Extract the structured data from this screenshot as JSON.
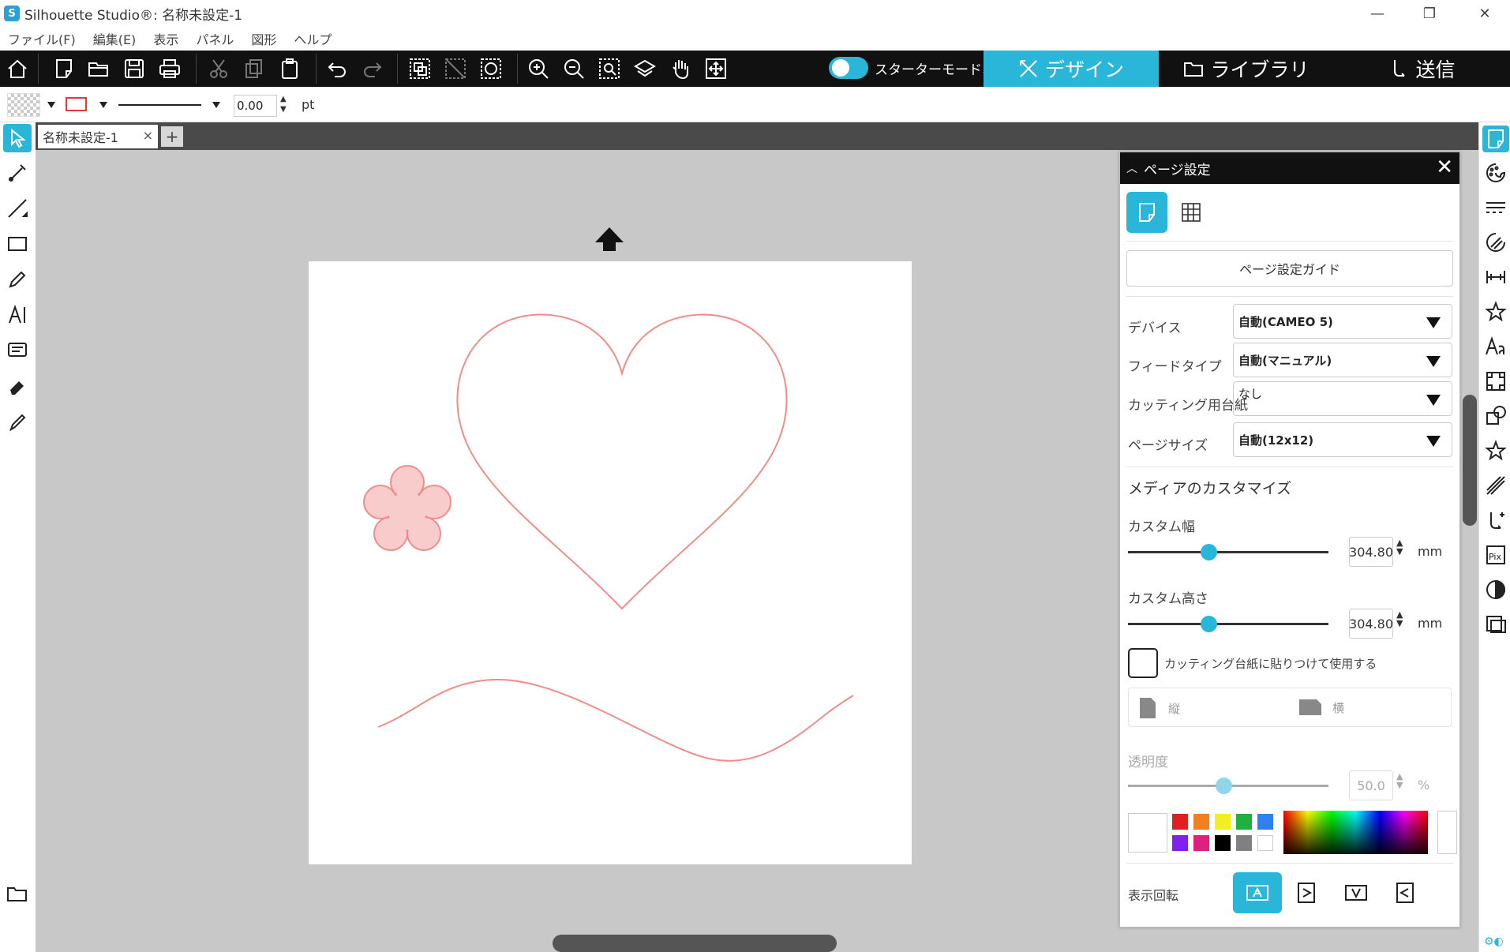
{
  "window": {
    "title": "Silhouette Studio®: 名称未設定-1",
    "minimize": "—",
    "maximize": "❐",
    "close": "✕"
  },
  "menu": [
    "ファイル(F)",
    "編集(E)",
    "表示",
    "パネル",
    "図形",
    "ヘルプ"
  ],
  "toolbar": {
    "starter_mode": "スターターモードオフ",
    "tabs": [
      {
        "label": "デザイン",
        "icon": "design-icon",
        "active": true
      },
      {
        "label": "ライブラリ",
        "icon": "folder-icon",
        "active": false
      },
      {
        "label": "送信",
        "icon": "send-icon",
        "active": false
      }
    ],
    "accent": "#29b6d8"
  },
  "propbar": {
    "line_width": "0.00",
    "unit": "pt",
    "line_color": "#e53935"
  },
  "doc_tab": {
    "name": "名称未設定-1",
    "close": "×",
    "add": "+"
  },
  "canvas": {
    "shape_stroke": "#f28b8b",
    "flower_fill": "#f9cccc"
  },
  "panel": {
    "title": "ページ設定",
    "guide_button": "ページ設定ガイド",
    "device_label": "デバイス",
    "device_value": "自動(CAMEO 5)",
    "feed_label": "フィードタイプ",
    "feed_value": "自動(マニュアル)",
    "mat_label": "カッティング用台紙",
    "mat_value": "なし",
    "pagesize_label": "ページサイズ",
    "pagesize_value": "自動(12x12)",
    "media_heading": "メディアのカスタマイズ",
    "width_label": "カスタム幅",
    "width_value": "304.80",
    "height_label": "カスタム高さ",
    "height_value": "304.80",
    "unit_mm": "mm",
    "slider_fraction": 0.4,
    "mat_check_label": "カッティング台紙に貼りつけて使用する",
    "mat_checked": false,
    "portrait_label": "縦",
    "landscape_label": "横",
    "transparency_label": "透明度",
    "transparency_value": "50.0",
    "transparency_unit": "%",
    "rotation_label": "表示回転",
    "palette": [
      "#e02020",
      "#f08020",
      "#f0f020",
      "#20b040",
      "#3080f0",
      "#8020f0",
      "#e02080",
      "#000000",
      "#808080",
      "#ffffff"
    ]
  }
}
